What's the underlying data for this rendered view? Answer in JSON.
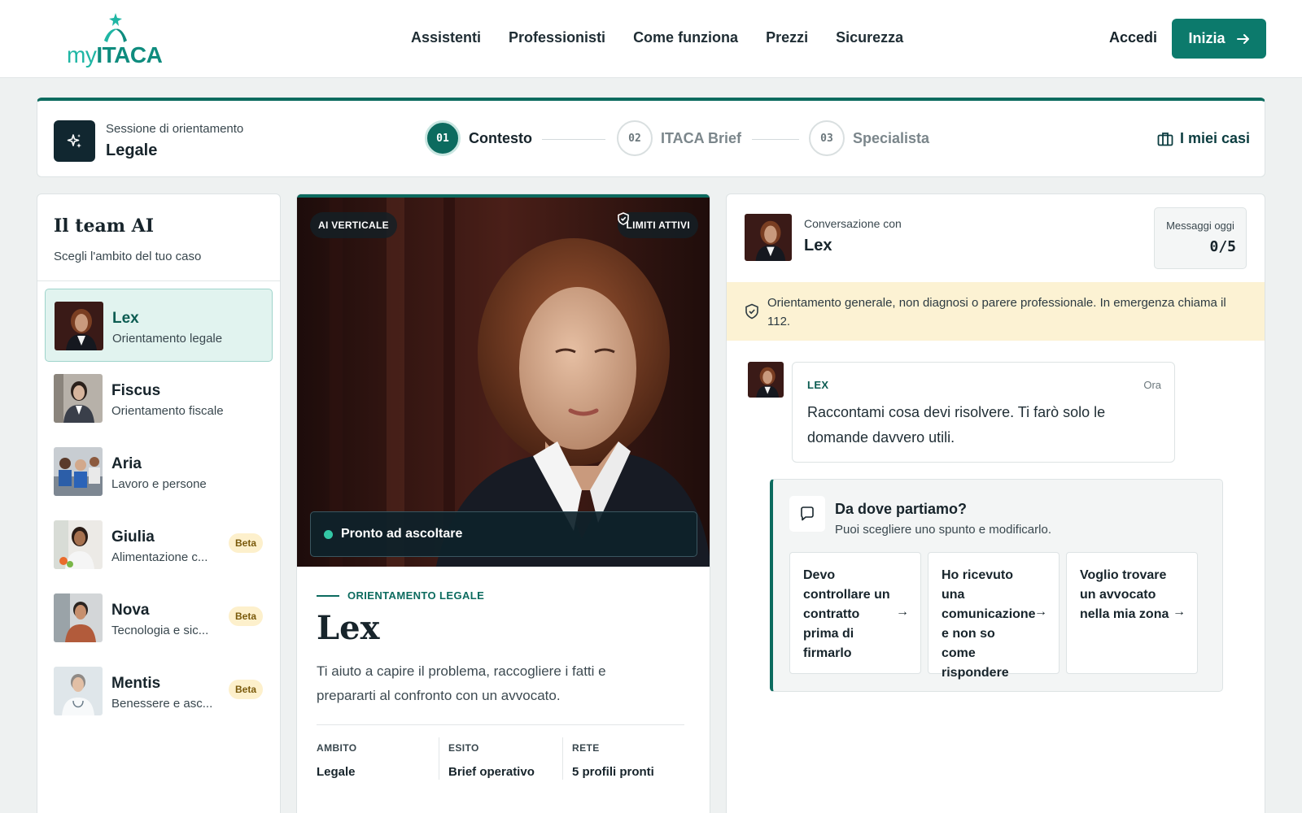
{
  "nav": {
    "logo_my": "my",
    "logo_itaca": "ITACA",
    "links": [
      "Assistenti",
      "Professionisti",
      "Come funziona",
      "Prezzi",
      "Sicurezza"
    ],
    "login": "Accedi",
    "cta": "Inizia"
  },
  "session": {
    "subtitle": "Sessione di orientamento",
    "title": "Legale",
    "steps": [
      {
        "num": "01",
        "label": "Contesto"
      },
      {
        "num": "02",
        "label": "ITACA Brief"
      },
      {
        "num": "03",
        "label": "Specialista"
      }
    ],
    "cases_label": "I miei casi"
  },
  "team": {
    "title": "Il team AI",
    "subtitle": "Scegli l'ambito del tuo caso",
    "agents": [
      {
        "name": "Lex",
        "role": "Orientamento legale",
        "badge": ""
      },
      {
        "name": "Fiscus",
        "role": "Orientamento fiscale",
        "badge": ""
      },
      {
        "name": "Aria",
        "role": "Lavoro e persone",
        "badge": ""
      },
      {
        "name": "Giulia",
        "role": "Alimentazione c...",
        "badge": "Beta"
      },
      {
        "name": "Nova",
        "role": "Tecnologia e sic...",
        "badge": "Beta"
      },
      {
        "name": "Mentis",
        "role": "Benessere e asc...",
        "badge": "Beta"
      }
    ]
  },
  "profile": {
    "chip_left": "AI VERTICALE",
    "chip_right": "LIMITI ATTIVI",
    "status": "Pronto ad ascoltare",
    "kicker": "ORIENTAMENTO LEGALE",
    "name": "Lex",
    "description": "Ti aiuto a capire il problema, raccogliere i fatti e prepararti al confronto con un avvocato.",
    "meta": [
      {
        "key": "AMBITO",
        "value": "Legale"
      },
      {
        "key": "ESITO",
        "value": "Brief operativo"
      },
      {
        "key": "RETE",
        "value": "5 profili pronti"
      }
    ]
  },
  "chat": {
    "subtitle": "Conversazione con",
    "name": "Lex",
    "messages_label": "Messaggi oggi",
    "messages_count": "0/5",
    "disclaimer": "Orientamento generale, non diagnosi o parere professionale. In emergenza chiama il 112.",
    "message": {
      "from": "LEX",
      "time": "Ora",
      "text": "Raccontami cosa devi risolvere. Ti farò solo le domande davvero utili."
    },
    "starter": {
      "title": "Da dove partiamo?",
      "subtitle": "Puoi scegliere uno spunto e modificarlo.",
      "options": [
        "Devo controllare un contratto prima di firmarlo",
        "Ho ricevuto una comunicazione e non so come rispondere",
        "Voglio trovare un avvocato nella mia zona"
      ]
    }
  },
  "colors": {
    "brand": "#0c6b5f",
    "brand_button": "#0c7a6c",
    "logo_teal": "#1fb6a4",
    "warning_bg": "#fcf2d3",
    "beta_bg": "#fdf0cc",
    "selected_bg": "#e1f3ef"
  }
}
